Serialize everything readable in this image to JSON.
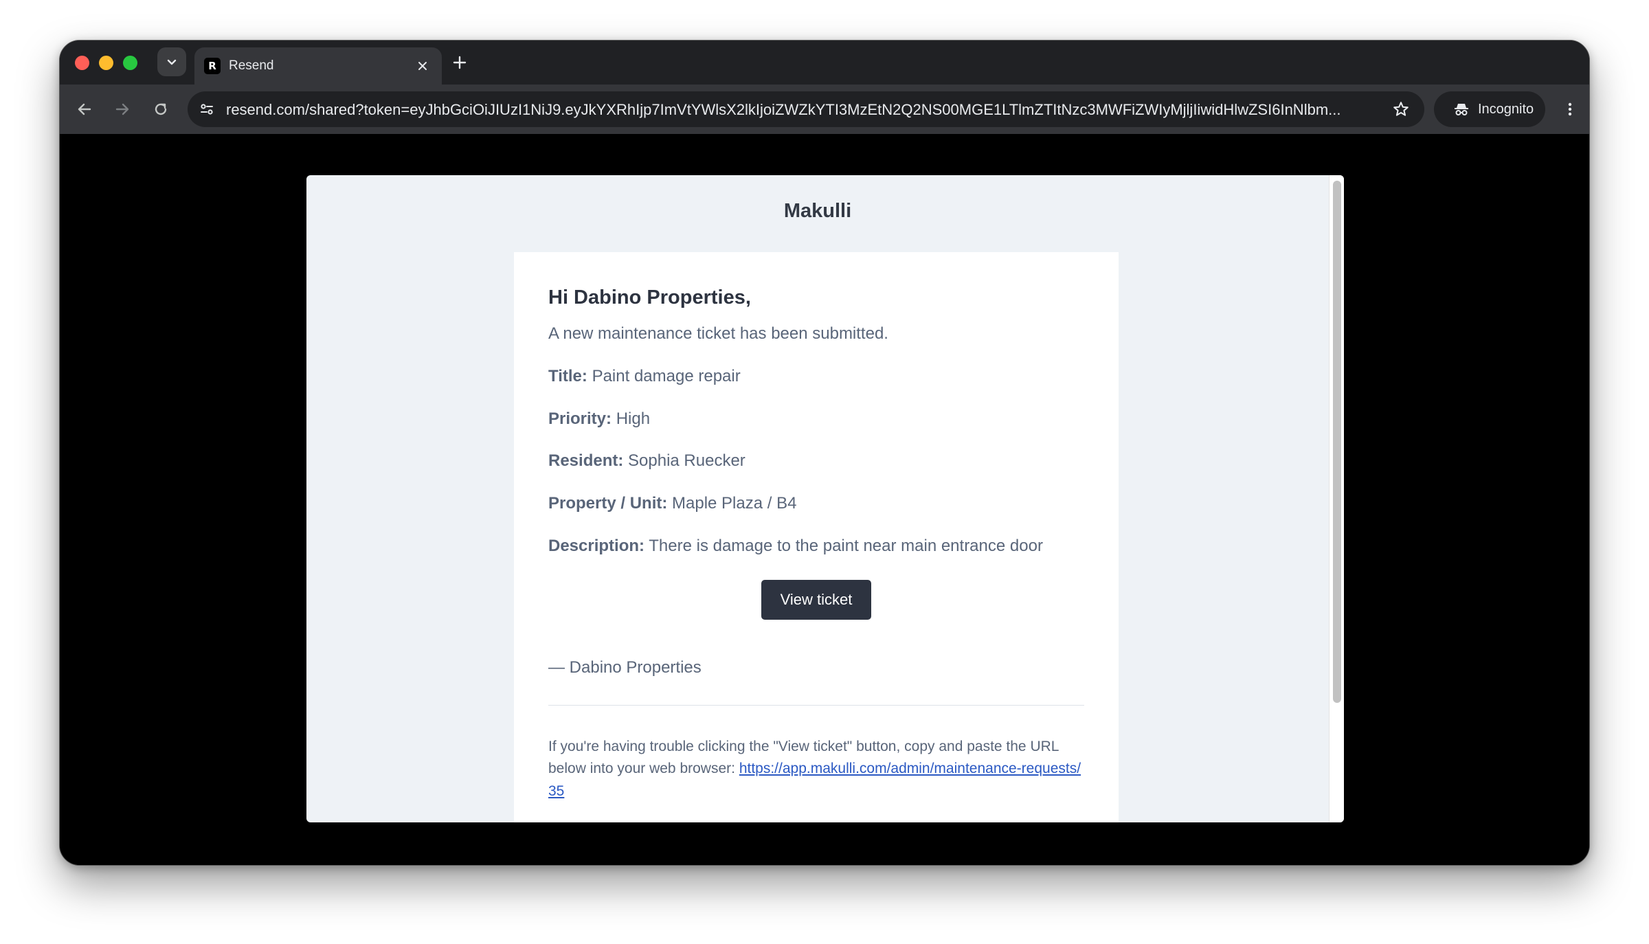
{
  "browser": {
    "tab_title": "Resend",
    "url_host": "resend.com",
    "url_path": "/shared?token=eyJhbGciOiJIUzI1NiJ9.eyJkYXRhIjp7ImVtYWlsX2lkIjoiZWZkYTI3MzEtN2Q2NS00MGE1LTlmZTItNzc3MWFiZWIyMjljIiwidHlwZSI6InNlbm...",
    "incognito_label": "Incognito"
  },
  "email": {
    "brand": "Makulli",
    "greeting": "Hi Dabino Properties,",
    "intro": "A new maintenance ticket has been submitted.",
    "fields": [
      {
        "label": "Title:",
        "value": "Paint damage repair"
      },
      {
        "label": "Priority:",
        "value": "High"
      },
      {
        "label": "Resident:",
        "value": "Sophia Ruecker"
      },
      {
        "label": "Property / Unit:",
        "value": "Maple Plaza / B4"
      },
      {
        "label": "Description:",
        "value": "There is damage to the paint near main entrance door"
      }
    ],
    "button_label": "View ticket",
    "signoff": "— Dabino Properties",
    "footer_text": "If you're having trouble clicking the \"View ticket\" button, copy and paste the URL below into your web browser:",
    "footer_link": "https://app.makulli.com/admin/maintenance-requests/35"
  },
  "icons": {
    "favicon": "resend-logo-icon",
    "site_info": "tune-icon",
    "incognito": "incognito-icon"
  }
}
